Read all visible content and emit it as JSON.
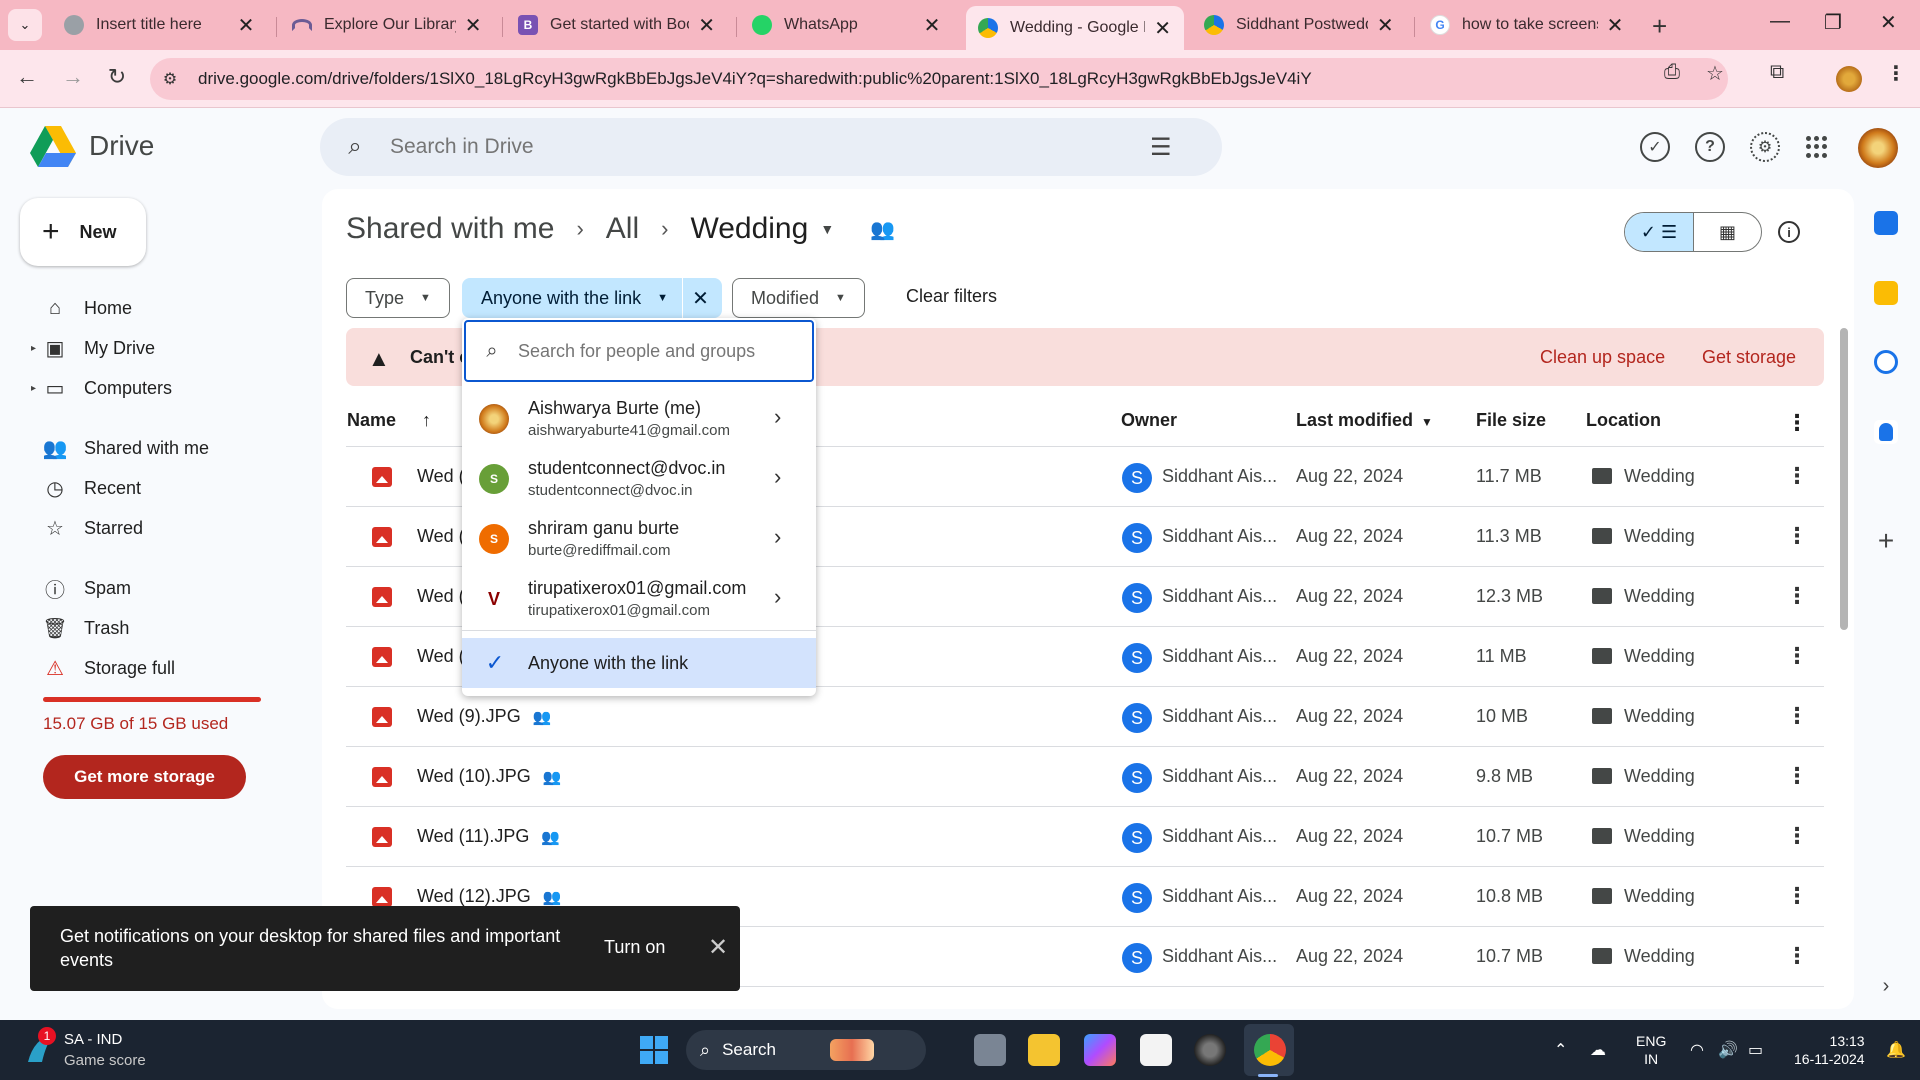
{
  "browser": {
    "tabs": [
      {
        "title": "Insert title here",
        "favicon": "globe-icon",
        "color": "#9aa0a6"
      },
      {
        "title": "Explore Our Library -",
        "favicon": "arc-icon",
        "color": "#6b5b95"
      },
      {
        "title": "Get started with Boot",
        "favicon": "bootstrap-icon",
        "color": "#7952b3",
        "letter": "B"
      },
      {
        "title": "WhatsApp",
        "favicon": "whatsapp-icon",
        "color": "#25d366"
      },
      {
        "title": "Wedding - Google D",
        "favicon": "drive-icon",
        "color": "#1a73e8"
      },
      {
        "title": "Siddhant Postweddin",
        "favicon": "drive-icon",
        "color": "#34a853"
      },
      {
        "title": "how to take screensh",
        "favicon": "google-icon",
        "color": "#4285f4",
        "letter": "G"
      }
    ],
    "active_tab_index": 4,
    "url": "drive.google.com/drive/folders/1SlX0_18LgRcyH3gwRgkBbEbJgsJeV4iY?q=sharedwith:public%20parent:1SlX0_18LgRcyH3gwRgkBbEbJgsJeV4iY"
  },
  "app": {
    "name": "Drive",
    "search_placeholder": "Search in Drive"
  },
  "sidebar": {
    "new_label": "New",
    "items": [
      {
        "label": "Home",
        "icon": "home-icon"
      },
      {
        "label": "My Drive",
        "icon": "my-drive-icon"
      },
      {
        "label": "Computers",
        "icon": "computer-icon"
      },
      {
        "label": "Shared with me",
        "icon": "people-icon"
      },
      {
        "label": "Recent",
        "icon": "clock-icon"
      },
      {
        "label": "Starred",
        "icon": "star-icon"
      },
      {
        "label": "Spam",
        "icon": "spam-icon"
      },
      {
        "label": "Trash",
        "icon": "trash-icon"
      },
      {
        "label": "Storage full",
        "icon": "warning-icon"
      }
    ],
    "storage_used": "15.07 GB of 15 GB used",
    "storage_fraction": 1.0,
    "get_more_storage": "Get more storage"
  },
  "breadcrumb": {
    "items": [
      "Shared with me",
      "All",
      "Wedding"
    ]
  },
  "filters": {
    "type": "Type",
    "people": "Anyone with the link",
    "modified": "Modified",
    "clear": "Clear filters"
  },
  "banner": {
    "message": "Can't c",
    "actions": [
      "Clean up space",
      "Get storage"
    ]
  },
  "table": {
    "columns": {
      "name": "Name",
      "owner": "Owner",
      "last_modified": "Last modified",
      "file_size": "File size",
      "location": "Location"
    },
    "rows": [
      {
        "name": "Wed (",
        "owner": "Siddhant Ais...",
        "owner_initial": "S",
        "modified": "Aug 22, 2024",
        "size": "11.7 MB",
        "location": "Wedding"
      },
      {
        "name": "Wed (",
        "owner": "Siddhant Ais...",
        "owner_initial": "S",
        "modified": "Aug 22, 2024",
        "size": "11.3 MB",
        "location": "Wedding"
      },
      {
        "name": "Wed (",
        "owner": "Siddhant Ais...",
        "owner_initial": "S",
        "modified": "Aug 22, 2024",
        "size": "12.3 MB",
        "location": "Wedding"
      },
      {
        "name": "Wed (",
        "owner": "Siddhant Ais...",
        "owner_initial": "S",
        "modified": "Aug 22, 2024",
        "size": "11 MB",
        "location": "Wedding"
      },
      {
        "name": "Wed (9).JPG",
        "owner": "Siddhant Ais...",
        "owner_initial": "S",
        "modified": "Aug 22, 2024",
        "size": "10 MB",
        "location": "Wedding"
      },
      {
        "name": "Wed (10).JPG",
        "owner": "Siddhant Ais...",
        "owner_initial": "S",
        "modified": "Aug 22, 2024",
        "size": "9.8 MB",
        "location": "Wedding"
      },
      {
        "name": "Wed (11).JPG",
        "owner": "Siddhant Ais...",
        "owner_initial": "S",
        "modified": "Aug 22, 2024",
        "size": "10.7 MB",
        "location": "Wedding"
      },
      {
        "name": "Wed (12).JPG",
        "owner": "Siddhant Ais...",
        "owner_initial": "S",
        "modified": "Aug 22, 2024",
        "size": "10.8 MB",
        "location": "Wedding"
      },
      {
        "name": "",
        "owner": "Siddhant Ais...",
        "owner_initial": "S",
        "modified": "Aug 22, 2024",
        "size": "10.7 MB",
        "location": "Wedding"
      }
    ]
  },
  "people_dropdown": {
    "search_placeholder": "Search for people and groups",
    "people": [
      {
        "name": "Aishwarya Burte (me)",
        "email": "aishwaryaburte41@gmail.com",
        "color": "#d08a1e",
        "initial": ""
      },
      {
        "name": "studentconnect@dvoc.in",
        "email": "studentconnect@dvoc.in",
        "color": "#689f38",
        "initial": "S"
      },
      {
        "name": "shriram ganu burte",
        "email": "burte@rediffmail.com",
        "color": "#ef6c00",
        "initial": "S"
      },
      {
        "name": "tirupatixerox01@gmail.com",
        "email": "tirupatixerox01@gmail.com",
        "color": "#ffffff",
        "initial": "V"
      }
    ],
    "selected": "Anyone with the link"
  },
  "toast": {
    "message": "Get notifications on your desktop for shared files and important events",
    "action": "Turn on"
  },
  "taskbar": {
    "weather_title": "SA - IND",
    "weather_sub": "Game score",
    "weather_badge": "1",
    "search": "Search",
    "lang_top": "ENG",
    "lang_bottom": "IN",
    "time": "13:13",
    "date": "16-11-2024"
  }
}
